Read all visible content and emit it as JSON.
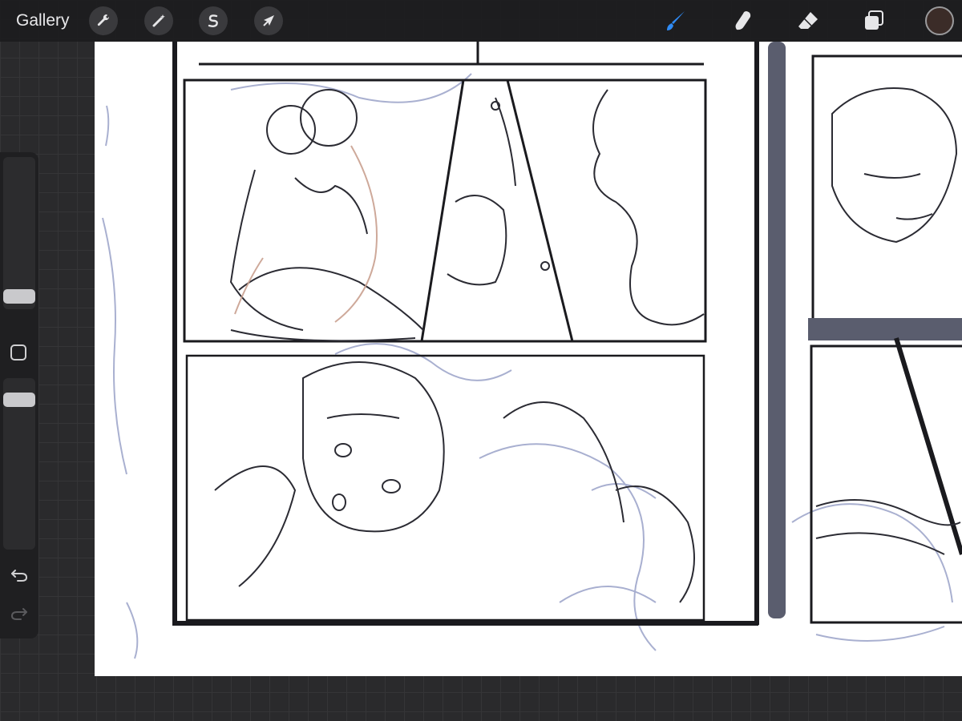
{
  "toolbar": {
    "gallery_label": "Gallery",
    "left_tools": [
      {
        "name": "actions",
        "icon": "wrench-icon"
      },
      {
        "name": "adjustments",
        "icon": "magic-wand-icon"
      },
      {
        "name": "selection",
        "icon": "selection-s-icon"
      },
      {
        "name": "transform",
        "icon": "arrow-cursor-icon"
      }
    ],
    "right_tools": [
      {
        "name": "brush",
        "icon": "brush-icon",
        "active": true
      },
      {
        "name": "smudge",
        "icon": "smudge-finger-icon",
        "active": false
      },
      {
        "name": "eraser",
        "icon": "eraser-icon",
        "active": false
      },
      {
        "name": "layers",
        "icon": "layers-icon",
        "active": false
      }
    ],
    "current_color": "#3b2c28",
    "active_tool_color": "#2f8bf5"
  },
  "sidebar": {
    "brush_size_level": 0.72,
    "opacity_level": 0.45,
    "undo_icon": "undo-arrow-icon",
    "redo_icon": "redo-arrow-icon",
    "modify_icon": "square-modify-icon"
  },
  "canvas": {
    "background": "#ffffff",
    "line_color": "#1e1e24",
    "sketch_color": "#8890b8",
    "accent_sketch_color": "#c9a08f"
  }
}
